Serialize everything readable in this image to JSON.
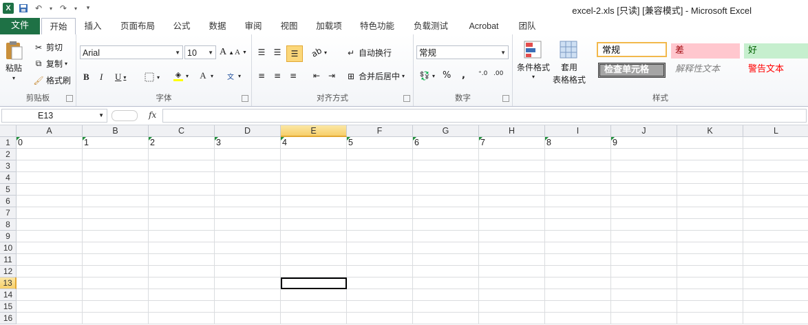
{
  "title": "excel-2.xls  [只读]  [兼容模式] - Microsoft Excel",
  "tabs": [
    "文件",
    "开始",
    "插入",
    "页面布局",
    "公式",
    "数据",
    "审阅",
    "视图",
    "加载项",
    "特色功能",
    "负载测试",
    "Acrobat",
    "团队"
  ],
  "clipboard": {
    "paste": "粘贴",
    "cut": "剪切",
    "copy": "复制",
    "format_painter": "格式刷",
    "label": "剪贴板"
  },
  "font": {
    "name": "Arial",
    "size": "10",
    "label": "字体"
  },
  "alignment": {
    "wrap": "自动换行",
    "merge": "合并后居中",
    "label": "对齐方式"
  },
  "number": {
    "format": "常规",
    "label": "数字"
  },
  "styles": {
    "conditional": "条件格式",
    "table1": "套用",
    "table2": "表格格式",
    "normal": "常规",
    "bad": "差",
    "good": "好",
    "check": "检查单元格",
    "explanatory": "解释性文本",
    "warning": "警告文本",
    "label": "样式"
  },
  "namebox": "E13",
  "fx_label": "fx",
  "columns": [
    "A",
    "B",
    "C",
    "D",
    "E",
    "F",
    "G",
    "H",
    "I",
    "J",
    "K",
    "L"
  ],
  "rows": [
    "1",
    "2",
    "3",
    "4",
    "5",
    "6",
    "7",
    "8",
    "9",
    "10",
    "11",
    "12",
    "13",
    "14",
    "15",
    "16"
  ],
  "row1_values": [
    "0",
    "1",
    "2",
    "3",
    "4",
    "5",
    "6",
    "7",
    "8",
    "9"
  ]
}
